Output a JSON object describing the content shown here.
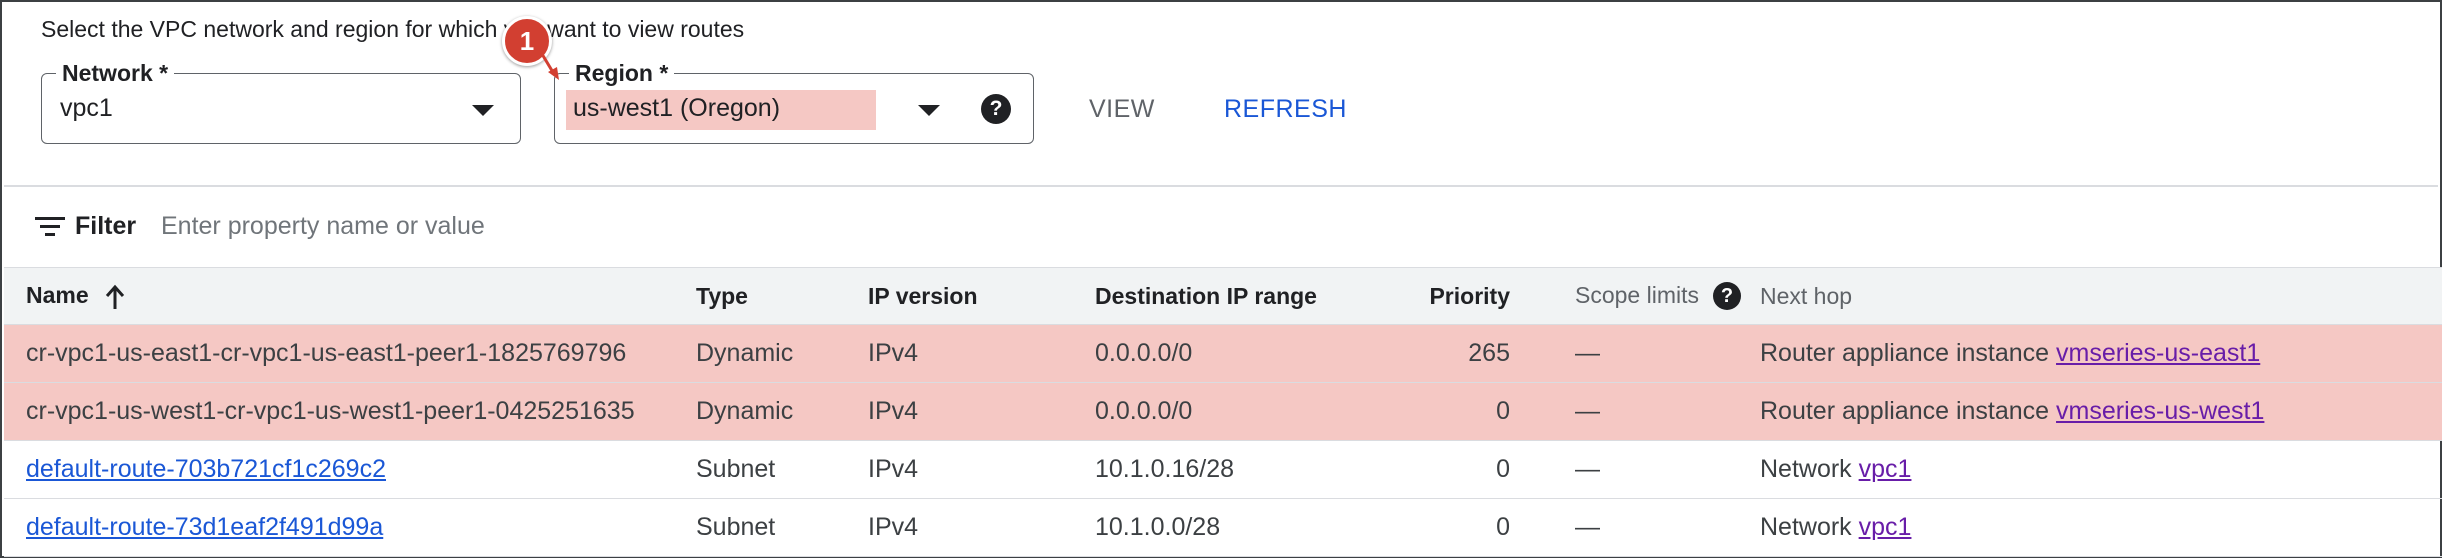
{
  "prompt_text": "Select the VPC network and region for which you want to view routes",
  "callout_number": "1",
  "network": {
    "label": "Network *",
    "value": "vpc1"
  },
  "region": {
    "label": "Region *",
    "value": "us-west1 (Oregon)",
    "help_glyph": "?"
  },
  "buttons": {
    "view": "VIEW",
    "refresh": "REFRESH"
  },
  "filter": {
    "label": "Filter",
    "placeholder": "Enter property name or value"
  },
  "columns": {
    "name": "Name",
    "type": "Type",
    "ip_version": "IP version",
    "destination": "Destination IP range",
    "priority": "Priority",
    "scope": "Scope limits",
    "scope_help": "?",
    "next_hop": "Next hop"
  },
  "rows": [
    {
      "name": "cr-vpc1-us-east1-cr-vpc1-us-east1-peer1-1825769796",
      "type": "Dynamic",
      "ip_version": "IPv4",
      "destination": "0.0.0.0/0",
      "priority": "265",
      "scope": "—",
      "next_hop_prefix": "Router appliance instance",
      "next_hop_link": "vmseries-us-east1"
    },
    {
      "name": "cr-vpc1-us-west1-cr-vpc1-us-west1-peer1-0425251635",
      "type": "Dynamic",
      "ip_version": "IPv4",
      "destination": "0.0.0.0/0",
      "priority": "0",
      "scope": "—",
      "next_hop_prefix": "Router appliance instance",
      "next_hop_link": "vmseries-us-west1"
    },
    {
      "name": "default-route-703b721cf1c269c2",
      "type": "Subnet",
      "ip_version": "IPv4",
      "destination": "10.1.0.16/28",
      "priority": "0",
      "scope": "—",
      "next_hop_prefix": "Network",
      "next_hop_link": "vpc1"
    },
    {
      "name": "default-route-73d1eaf2f491d99a",
      "type": "Subnet",
      "ip_version": "IPv4",
      "destination": "10.1.0.0/28",
      "priority": "0",
      "scope": "—",
      "next_hop_prefix": "Network",
      "next_hop_link": "vpc1"
    }
  ],
  "colors": {
    "highlight": "#f5c8c4",
    "link_blue": "#1a57d6",
    "link_visited": "#681da8",
    "callout": "#d23f31"
  }
}
